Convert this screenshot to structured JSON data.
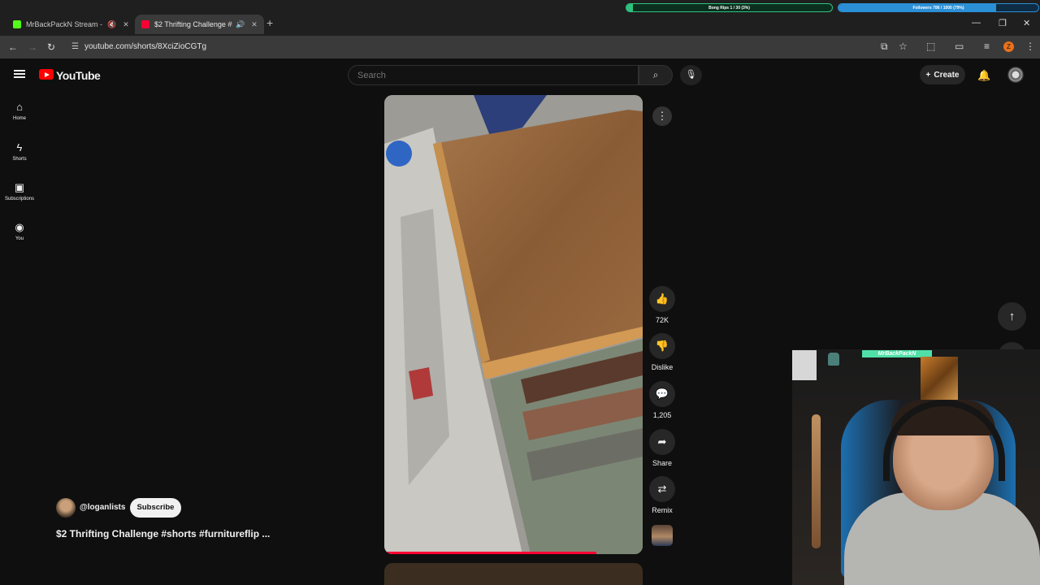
{
  "browser": {
    "tabs": [
      {
        "title": "MrBackPackN Stream - Wat",
        "active": false,
        "favicon_color": "#53fc18",
        "indicator": "🔇"
      },
      {
        "title": "$2 Thrifting Challenge #sh",
        "active": true,
        "favicon_color": "#ff0033",
        "indicator": "🔊"
      }
    ],
    "new_tab": "+",
    "address": "youtube.com/shorts/8XciZioCGTg",
    "profile_initial": "Z"
  },
  "overlay": {
    "goal_1": {
      "text": "Bong Rips 1 / 30 (3%)",
      "percent": 3,
      "color": "#2ec27e",
      "track": "#0b2f1f"
    },
    "goal_2": {
      "text": "Followers 786 / 1000 (79%)",
      "percent": 79,
      "color": "#2b8fd6",
      "track": "#0e2c44"
    },
    "cam_banner": "MrBackPackN"
  },
  "header": {
    "logo_text": "YouTube",
    "search_placeholder": "Search",
    "create_label": "Create"
  },
  "sidebar": {
    "items": [
      {
        "label": "Home",
        "icon": "home-icon"
      },
      {
        "label": "Shorts",
        "icon": "shorts-icon"
      },
      {
        "label": "Subscriptions",
        "icon": "subscriptions-icon"
      },
      {
        "label": "You",
        "icon": "you-icon"
      }
    ]
  },
  "short": {
    "progress_fraction": 0.82,
    "channel": "@loganlists",
    "subscribe_label": "Subscribe",
    "title": "$2 Thrifting Challenge #shorts #furnitureflip ..."
  },
  "actions": {
    "like_count": "72K",
    "dislike_label": "Dislike",
    "comment_count": "1,205",
    "share_label": "Share",
    "remix_label": "Remix"
  },
  "colors": {
    "accent": "#ff0000",
    "progress": "#ff0033"
  }
}
